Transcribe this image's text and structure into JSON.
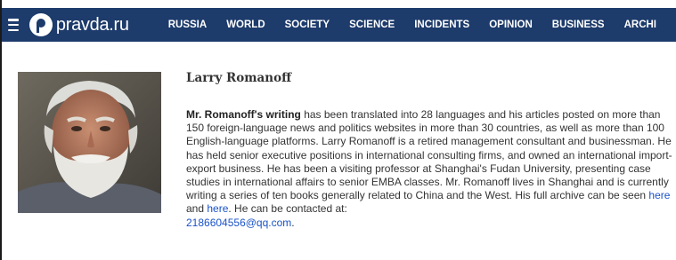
{
  "header": {
    "logo_name": "pravda",
    "logo_tld": ".ru",
    "nav": [
      {
        "label": "RUSSIA"
      },
      {
        "label": "WORLD"
      },
      {
        "label": "SOCIETY"
      },
      {
        "label": "SCIENCE"
      },
      {
        "label": "INCIDENTS"
      },
      {
        "label": "OPINION"
      },
      {
        "label": "BUSINESS"
      },
      {
        "label": "ARCHI"
      }
    ],
    "icons": {
      "menu": "hamburger-menu-icon",
      "logo": "pravda-logo-icon"
    },
    "colors": {
      "navbar_bg": "#1d3b6b",
      "link": "#1a52c9"
    }
  },
  "author": {
    "name": "Larry Romanoff",
    "photo": "author-portrait",
    "bio": {
      "lead": "Mr. Romanoff's writing",
      "text": " has been translated into 28 languages and his articles posted on more than 150 foreign-language news and politics websites in more than 30 countries, as well as more than 100 English-language platforms. Larry Romanoff is a retired management consultant and businessman. He has held senior executive positions in international consulting firms, and owned an international import-export business. He has been a visiting professor at Shanghai's Fudan University, presenting case studies in international affairs to senior EMBA classes. Mr. Romanoff lives in Shanghai and is currently writing a series of ten books generally related to China and the West. His full archive can be seen ",
      "link1": "here",
      "between": "  and ",
      "link2": "here",
      "after": ". He can be contacted at:",
      "email": "2186604556@qq.com",
      "end": "."
    }
  }
}
